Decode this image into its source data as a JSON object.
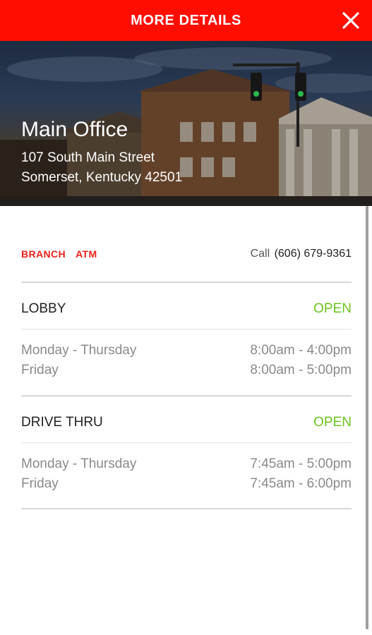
{
  "header": {
    "title": "MORE DETAILS",
    "close_icon": "close-icon",
    "background_color": "#ff0e00"
  },
  "location": {
    "name": "Main Office",
    "address_line1": "107 South Main Street",
    "address_line2": "Somerset, Kentucky 42501"
  },
  "services": {
    "tags": [
      "BRANCH",
      "ATM"
    ],
    "call_label": "Call",
    "phone": "(606) 679-9361"
  },
  "lobby": {
    "title": "LOBBY",
    "status": "OPEN",
    "hours": [
      {
        "days": "Monday - Thursday",
        "time": "8:00am - 4:00pm"
      },
      {
        "days": "Friday",
        "time": "8:00am - 5:00pm"
      }
    ]
  },
  "drive_thru": {
    "title": "DRIVE THRU",
    "status": "OPEN",
    "hours": [
      {
        "days": "Monday - Thursday",
        "time": "7:45am - 5:00pm"
      },
      {
        "days": "Friday",
        "time": "7:45am - 6:00pm"
      }
    ]
  },
  "colors": {
    "accent_red": "#ff0e00",
    "tag_red": "#e8211b",
    "open_green": "#6cc31e"
  }
}
